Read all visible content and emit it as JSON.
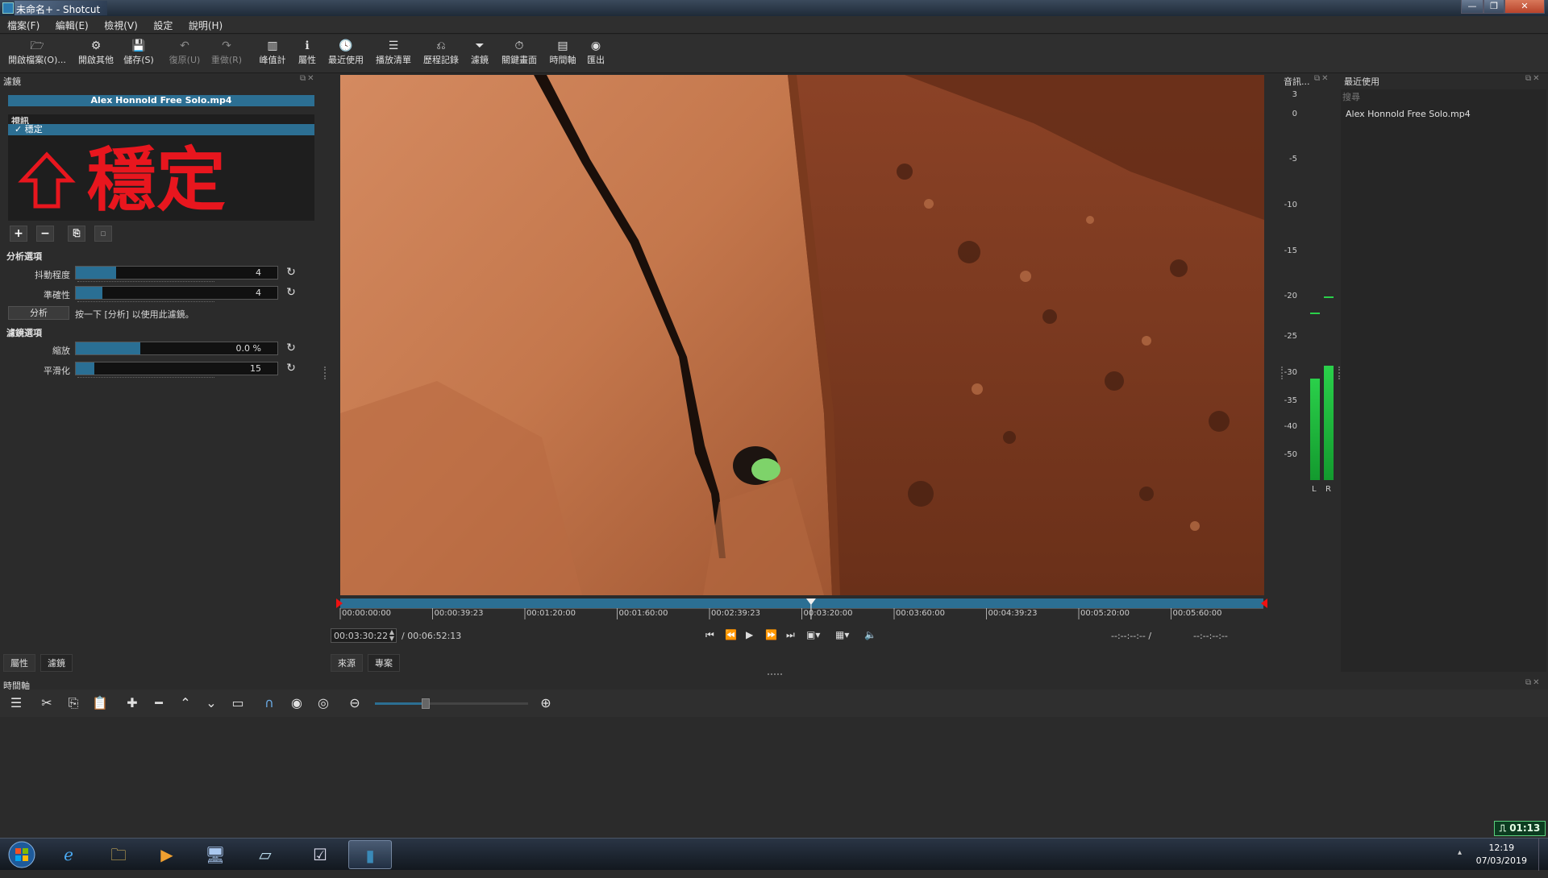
{
  "window": {
    "title": "未命名+ - Shotcut",
    "controls": [
      "—",
      "❐",
      "✕"
    ]
  },
  "menu": [
    "檔案(F)",
    "編輯(E)",
    "檢視(V)",
    "設定",
    "說明(H)"
  ],
  "toolbar": [
    {
      "label": "開啟檔案(O)...",
      "icon": "folder-open-icon",
      "glyph": "🗁",
      "enabled": true
    },
    {
      "label": "開啟其他",
      "icon": "open-other-icon",
      "glyph": "⚙",
      "enabled": true
    },
    {
      "label": "儲存(S)",
      "icon": "save-icon",
      "glyph": "💾",
      "enabled": true
    },
    {
      "label": "復原(U)",
      "icon": "undo-icon",
      "glyph": "↶",
      "enabled": false
    },
    {
      "label": "重做(R)",
      "icon": "redo-icon",
      "glyph": "↷",
      "enabled": false
    },
    {
      "label": "峰值計",
      "icon": "peak-meter-icon",
      "glyph": "▥",
      "enabled": true
    },
    {
      "label": "屬性",
      "icon": "info-icon",
      "glyph": "ℹ",
      "enabled": true
    },
    {
      "label": "最近使用",
      "icon": "clock-icon",
      "glyph": "🕓",
      "enabled": true
    },
    {
      "label": "播放清單",
      "icon": "playlist-icon",
      "glyph": "☰",
      "enabled": true
    },
    {
      "label": "歷程記錄",
      "icon": "history-icon",
      "glyph": "⎌",
      "enabled": true
    },
    {
      "label": "濾鏡",
      "icon": "filter-icon",
      "glyph": "⏷",
      "enabled": true
    },
    {
      "label": "關鍵畫面",
      "icon": "keyframes-icon",
      "glyph": "⏱",
      "enabled": true
    },
    {
      "label": "時間軸",
      "icon": "timeline-icon",
      "glyph": "▤",
      "enabled": true
    },
    {
      "label": "匯出",
      "icon": "export-icon",
      "glyph": "◉",
      "enabled": true
    }
  ],
  "filters_panel": {
    "title": "濾鏡",
    "clip_name": "Alex Honnold Free Solo.mp4",
    "category": "視訊",
    "items": [
      {
        "label": "穩定",
        "checked": true
      }
    ],
    "overlay_text": "穩定",
    "analysis_section": "分析選項",
    "params_analysis": [
      {
        "label": "抖動程度",
        "value": "4",
        "fill": 0.2
      },
      {
        "label": "準確性",
        "value": "4",
        "fill": 0.13
      }
    ],
    "analyze_button": "分析",
    "analyze_hint": "按一下 [分析] 以使用此濾鏡。",
    "filter_section": "濾鏡選項",
    "params_filter": [
      {
        "label": "縮放",
        "value": "0.0 %",
        "fill": 0.32
      },
      {
        "label": "平滑化",
        "value": "15",
        "fill": 0.09
      }
    ],
    "tabs": [
      "屬性",
      "濾鏡"
    ]
  },
  "player": {
    "ticks": [
      "00:00:00:00",
      "00:00:39:23",
      "00:01:20:00",
      "00:01:60:00",
      "00:02:39:23",
      "00:03:20:00",
      "00:03:60:00",
      "00:04:39:23",
      "00:05:20:00",
      "00:05:60:00"
    ],
    "current_time": "00:03:30:22",
    "total_time": "/ 00:06:52:13",
    "in_point": "--:--:--:-- /",
    "out_point": "--:--:--:--",
    "playhead_fraction": 0.51,
    "tabs": [
      "來源",
      "專案"
    ]
  },
  "audio_meter": {
    "title": "音訊...",
    "scale": [
      "3",
      "0",
      "-5",
      "-10",
      "-15",
      "-20",
      "-25",
      "-30",
      "-35",
      "-40",
      "-50"
    ],
    "channels": [
      "L",
      "R"
    ],
    "levels_db": [
      -31,
      -29
    ],
    "peaks_db": [
      -22,
      -20
    ]
  },
  "recent_panel": {
    "title": "最近使用",
    "search_placeholder": "搜尋",
    "items": [
      "Alex Honnold Free Solo.mp4"
    ]
  },
  "timeline": {
    "title": "時間軸",
    "zoom_fraction": 0.33
  },
  "taskbar": {
    "time": "12:19",
    "date": "07/03/2019",
    "badge": "01:13",
    "apps": [
      "windows-start-icon",
      "internet-explorer-icon",
      "file-explorer-icon",
      "media-player-icon",
      "remote-desktop-icon",
      "notes-icon",
      "checklist-icon",
      "shotcut-icon"
    ]
  }
}
